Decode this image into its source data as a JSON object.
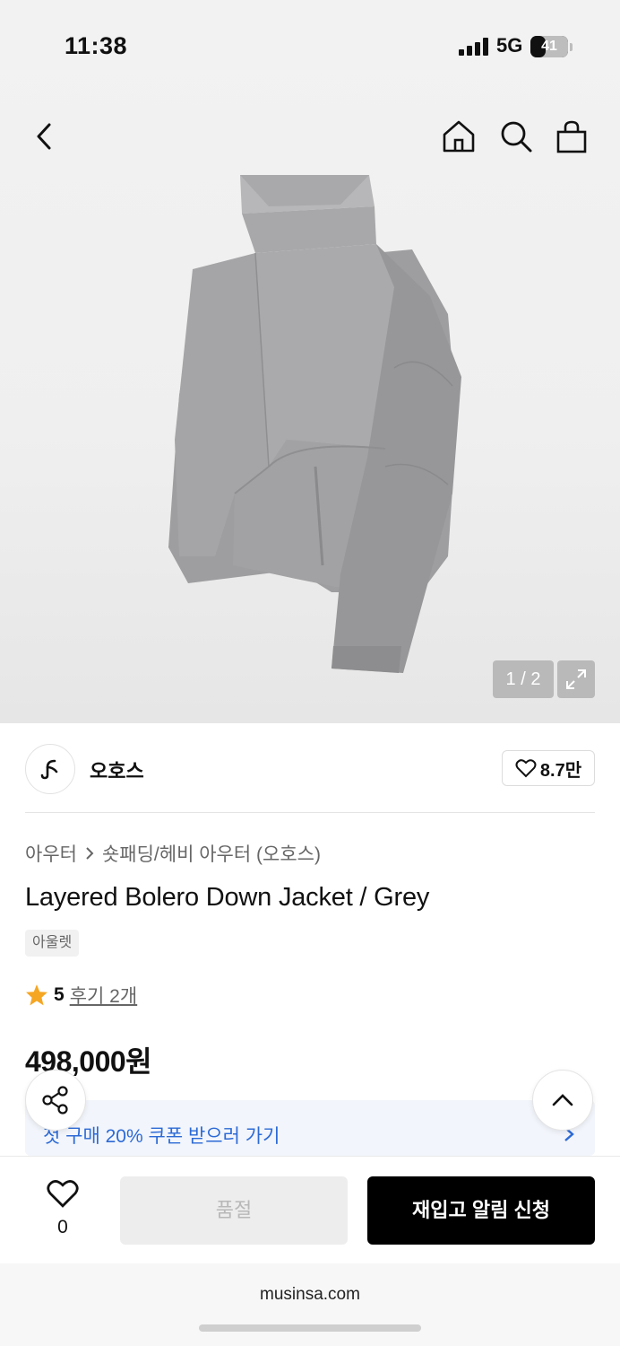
{
  "status": {
    "time": "11:38",
    "network": "5G",
    "battery": "41",
    "battery_level": 0.41
  },
  "nav": {
    "back": "back-icon",
    "home": "home-icon",
    "search": "search-icon",
    "cart": "shopping-bag-icon"
  },
  "gallery": {
    "counter": "1 / 2"
  },
  "brand": {
    "name": "오호스",
    "likes": "8.7만"
  },
  "breadcrumb": {
    "category": "아우터",
    "subcategory": "숏패딩/헤비 아우터 (오호스)"
  },
  "product": {
    "title": "Layered Bolero Down Jacket / Grey",
    "badge": "아울렛",
    "rating": "5",
    "reviews": "후기 2개",
    "price": "498,000원"
  },
  "coupon": {
    "text": "첫 구매 20% 쿠폰 받으러 가기"
  },
  "bottom": {
    "wish_count": "0",
    "soldout_label": "품절",
    "restock_label": "재입고 알림 신청"
  },
  "browser": {
    "url": "musinsa.com"
  },
  "colors": {
    "accent_blue": "#2c6ad6",
    "star": "#f5a623",
    "primary": "#000000"
  }
}
